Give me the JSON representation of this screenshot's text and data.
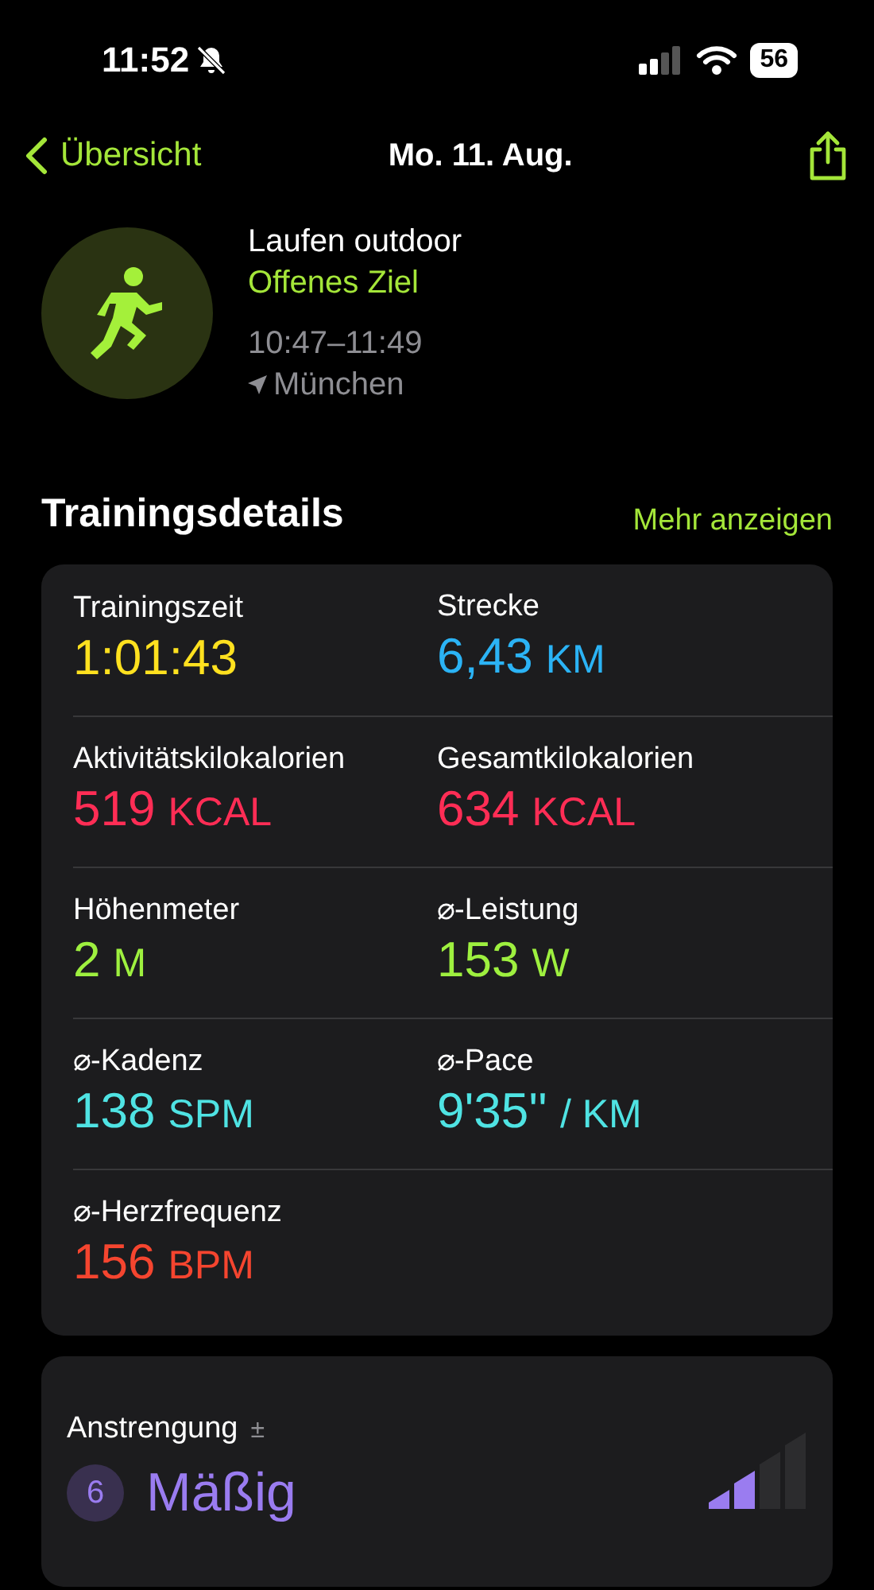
{
  "status_bar": {
    "time": "11:52",
    "silent": true,
    "battery": "56"
  },
  "nav": {
    "back": "Übersicht",
    "title": "Mo. 11. Aug."
  },
  "workout": {
    "name": "Laufen outdoor",
    "goal": "Offenes Ziel",
    "time_range": "10:47–11:49",
    "location": "München"
  },
  "details": {
    "title": "Trainingsdetails",
    "more": "Mehr anzeigen",
    "rows": [
      [
        {
          "label": "Trainingszeit",
          "value": "1:01:43",
          "color": "#ffe11f"
        },
        {
          "label": "Strecke",
          "value": "6,43",
          "unit": "KM",
          "color": "#2bb3f5"
        }
      ],
      [
        {
          "label": "Aktivitätskilokalorien",
          "value": "519",
          "unit": "KCAL",
          "color": "#ff2d55"
        },
        {
          "label": "Gesamtkilokalorien",
          "value": "634",
          "unit": "KCAL",
          "color": "#ff2d55"
        }
      ],
      [
        {
          "label": "Höhenmeter",
          "value": "2",
          "unit": "M",
          "color": "#9ef03f"
        },
        {
          "label": "⌀-Leistung",
          "value": "153",
          "unit": "W",
          "color": "#9ef03f"
        }
      ],
      [
        {
          "label": "⌀-Kadenz",
          "value": "138",
          "unit": "SPM",
          "color": "#4fe3e3"
        },
        {
          "label": "⌀-Pace",
          "value": "9'35''",
          "unit": "/ KM",
          "color": "#4fe3e3"
        }
      ],
      [
        {
          "label": "⌀-Herzfrequenz",
          "value": "156",
          "unit": "BPM",
          "color": "#f5452f"
        }
      ]
    ]
  },
  "effort": {
    "label": "Anstrengung",
    "adjust": "±",
    "score": "6",
    "rating": "Mäßig",
    "level": 0.5
  }
}
